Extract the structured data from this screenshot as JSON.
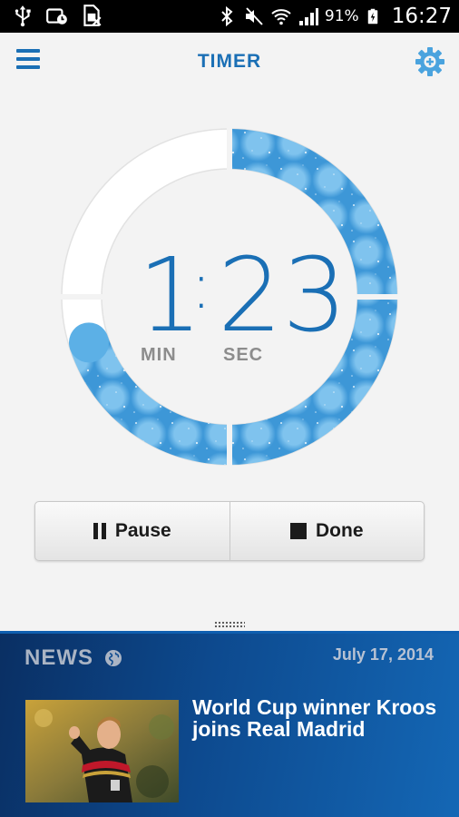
{
  "status_bar": {
    "icons_left": [
      "usb-icon",
      "screenshot-icon",
      "sim-off-icon"
    ],
    "icons_right": [
      "bluetooth-icon",
      "mute-icon",
      "wifi-icon",
      "signal-icon"
    ],
    "battery_percent": "91%",
    "time": "16:27"
  },
  "header": {
    "title": "TIMER",
    "menu_icon": "hamburger-menu-icon",
    "settings_icon": "gear-icon"
  },
  "timer": {
    "minutes": "1",
    "colon": ":",
    "seconds": "23",
    "min_label": "MIN",
    "sec_label": "SEC",
    "progress_fraction": 0.7,
    "accent_color": "#4aa3de"
  },
  "controls": {
    "pause_label": "Pause",
    "done_label": "Done"
  },
  "news": {
    "section_label": "NEWS",
    "date": "July 17, 2014",
    "headline": "World Cup winner Kroos joins Real Madrid",
    "globe_icon": "globe-icon"
  }
}
